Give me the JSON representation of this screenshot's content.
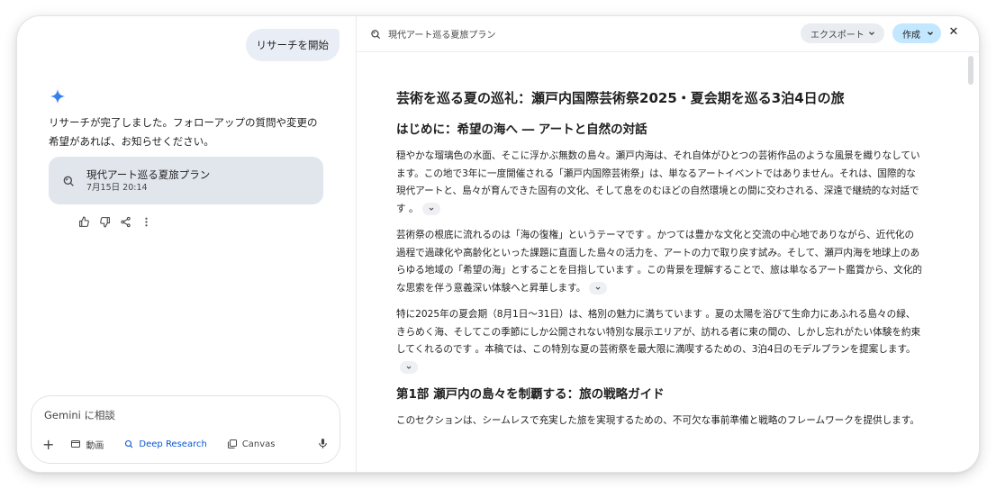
{
  "left": {
    "user_message": "リサーチを開始",
    "assistant_reply": "リサーチが完了しました。フォローアップの質問や変更の希望があれば、お知らせください。",
    "research_card": {
      "title": "現代アート巡る夏旅プラン",
      "date": "7月15日 20:14"
    },
    "actions": [
      "thumb-up-icon",
      "thumb-down-icon",
      "share-icon",
      "more-vert-icon"
    ],
    "input": {
      "placeholder": "Gemini に相談",
      "tools": {
        "video": "動画",
        "deep_research": "Deep Research",
        "canvas": "Canvas"
      }
    }
  },
  "right": {
    "doc_title": "現代アート巡る夏旅プラン",
    "export_label": "エクスポート",
    "create_label": "作成",
    "document": {
      "h1": "芸術を巡る夏の巡礼：瀬戸内国際芸術祭2025・夏会期を巡る3泊4日の旅",
      "sections": [
        {
          "heading": "はじめに：希望の海へ ― アートと自然の対話",
          "paragraphs": [
            "穏やかな瑠璃色の水面、そこに浮かぶ無数の島々。瀬戸内海は、それ自体がひとつの芸術作品のような風景を織りなしています。この地で3年に一度開催される「瀬戸内国際芸術祭」は、単なるアートイベントではありません。それは、国際的な現代アートと、島々が育んできた固有の文化、そして息をのむほどの自然環境との間に交わされる、深遠で継続的な対話です 。",
            "芸術祭の根底に流れるのは「海の復権」というテーマです 。かつては豊かな文化と交流の中心地でありながら、近代化の過程で過疎化や高齢化といった課題に直面した島々の活力を、アートの力で取り戻す試み。そして、瀬戸内海を地球上のあらゆる地域の「希望の海」とすることを目指しています 。この背景を理解することで、旅は単なるアート鑑賞から、文化的な思索を伴う意義深い体験へと昇華します。",
            "特に2025年の夏会期（8月1日～31日）は、格別の魅力に満ちています 。夏の太陽を浴びて生命力にあふれる島々の緑、きらめく海、そしてこの季節にしか公開されない特別な展示エリアが、訪れる者に束の間の、しかし忘れがたい体験を約束してくれるのです 。本稿では、この特別な夏の芸術祭を最大限に満喫するための、3泊4日のモデルプランを提案します。"
          ]
        },
        {
          "heading": "第1部 瀬戸内の島々を制覇する：旅の戦略ガイド",
          "paragraphs": [
            "このセクションは、シームレスで充実した旅を実現するための、不可欠な事前準備と戦略のフレームワークを提供します。"
          ]
        }
      ]
    }
  },
  "colors": {
    "accent": "#0b57d0",
    "card_bg": "#e1e6ed",
    "create_bg": "#c2e7ff"
  }
}
